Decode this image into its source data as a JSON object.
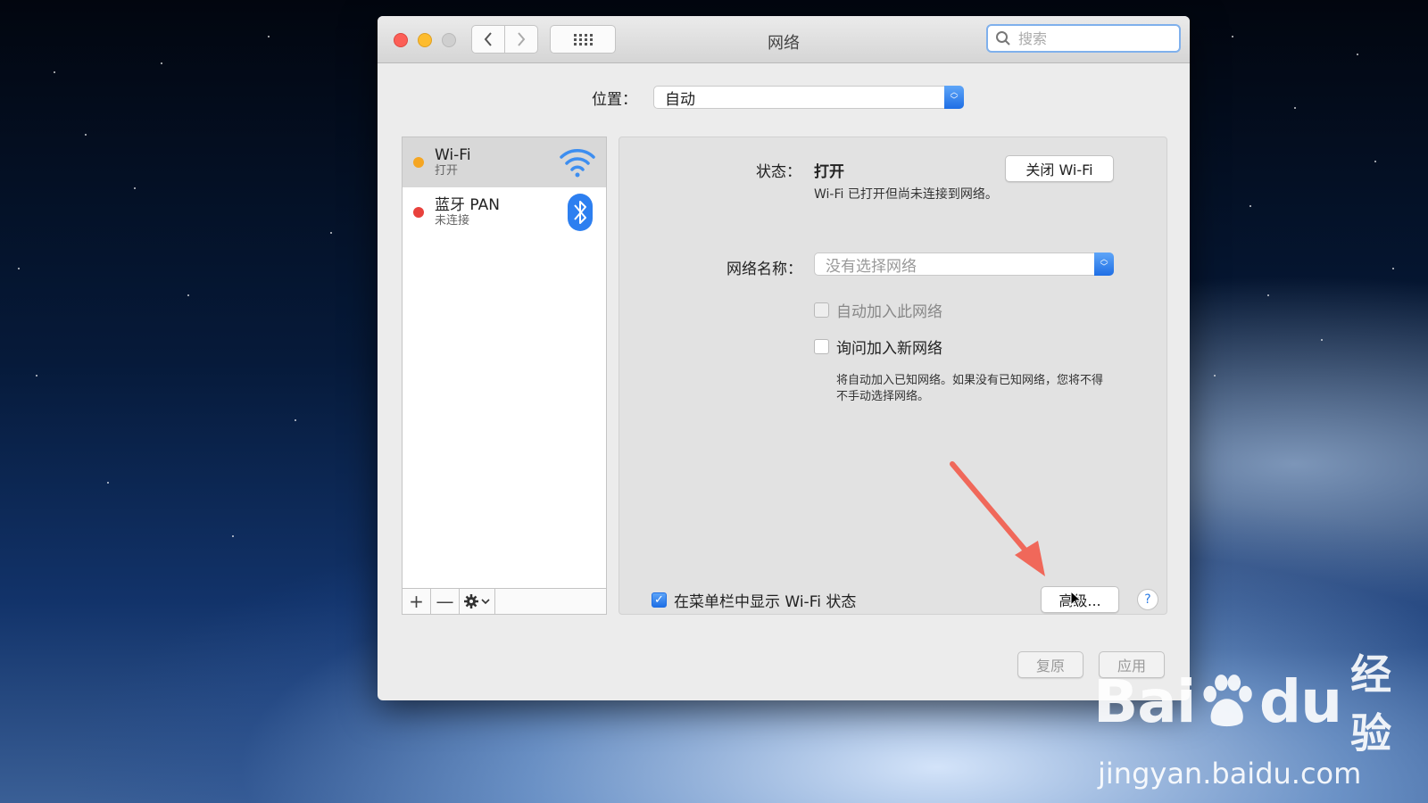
{
  "window": {
    "title": "网络",
    "search_placeholder": "搜索",
    "traffic_lights": [
      "close",
      "minimize",
      "zoom-disabled"
    ],
    "nav": {
      "back_icon": "chevron-left-icon",
      "forward_icon": "chevron-right-icon",
      "show_all_icon": "grid-icon"
    }
  },
  "location": {
    "label": "位置：",
    "value": "自动"
  },
  "services": [
    {
      "name": "Wi-Fi",
      "status": "打开",
      "dot_color": "#f5a623",
      "icon": "wifi-icon",
      "selected": true
    },
    {
      "name": "蓝牙 PAN",
      "status": "未连接",
      "dot_color": "#e8413c",
      "icon": "bluetooth-icon",
      "selected": false
    }
  ],
  "sidebar_footer": {
    "add": "+",
    "remove": "—",
    "actions_icon": "gear-icon"
  },
  "detail": {
    "status_label": "状态：",
    "status_value": "打开",
    "turn_off_button": "关闭 Wi-Fi",
    "status_description": "Wi-Fi 已打开但尚未连接到网络。",
    "network_name_label": "网络名称：",
    "network_name_placeholder": "没有选择网络",
    "auto_join_label": "自动加入此网络",
    "ask_join_label": "询问加入新网络",
    "ask_join_description": "将自动加入已知网络。如果没有已知网络，您将不得不手动选择网络。",
    "show_status_label": "在菜单栏中显示 Wi-Fi 状态",
    "advanced_button": "高级...",
    "help_button": "?"
  },
  "footer": {
    "revert_button": "复原",
    "apply_button": "应用"
  },
  "watermark": {
    "brand_left": "Bai",
    "brand_right": "du",
    "brand_cn": "经验",
    "url": "jingyan.baidu.com"
  },
  "colors": {
    "accent": "#1f6fe5",
    "annotation_arrow": "#f0685a"
  }
}
